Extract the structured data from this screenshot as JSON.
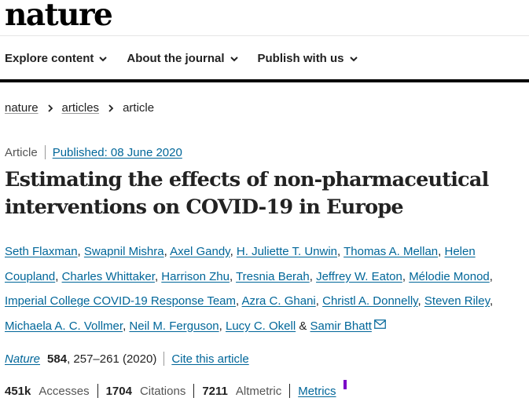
{
  "header": {
    "logo": "nature",
    "nav": [
      {
        "label": "Explore content"
      },
      {
        "label": "About the journal"
      },
      {
        "label": "Publish with us"
      }
    ]
  },
  "breadcrumb": {
    "items": [
      "nature",
      "articles"
    ],
    "current": "article"
  },
  "article": {
    "type": "Article",
    "published": "Published: 08 June 2020",
    "title_line1": "Estimating the effects of non-pharmaceutical",
    "title_line2": "interventions on COVID-19 in Europe",
    "authors": [
      "Seth Flaxman",
      "Swapnil Mishra",
      "Axel Gandy",
      "H. Juliette T. Unwin",
      "Thomas A. Mellan",
      "Helen Coupland",
      "Charles Whittaker",
      "Harrison Zhu",
      "Tresnia Berah",
      "Jeffrey W. Eaton",
      "Mélodie Monod",
      "Imperial College COVID-19 Response Team",
      "Azra C. Ghani",
      "Christl A. Donnelly",
      "Steven Riley",
      "Michaela A. C. Vollmer",
      "Neil M. Ferguson",
      "Lucy C. Okell",
      "Samir Bhatt"
    ],
    "author_separator": ",",
    "author_last_joiner": "&",
    "citation": {
      "journal": "Nature",
      "volume": "584",
      "pages": ", 257–261 (2020)",
      "cite_link": "Cite this article"
    },
    "metrics": {
      "accesses_value": "451k",
      "accesses_label": "Accesses",
      "citations_value": "1704",
      "citations_label": "Citations",
      "altmetric_value": "7211",
      "altmetric_label": "Altmetric",
      "metrics_link": "Metrics"
    }
  },
  "colors": {
    "link": "#006699",
    "text": "#222222",
    "altmetric_mark": "#7b00c8"
  },
  "icons": [
    "chevron-down-icon",
    "chevron-right-icon",
    "mail-icon"
  ]
}
